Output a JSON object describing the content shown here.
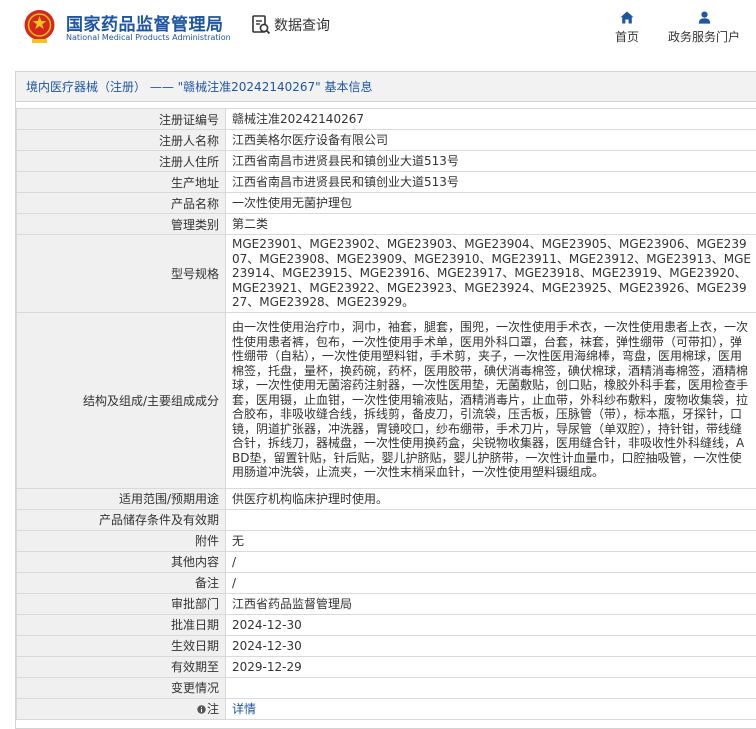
{
  "header": {
    "site_name": "国家药品监督管理局",
    "site_name_en": "National Medical Products Administration",
    "query_label": "数据查询",
    "nav": [
      {
        "label": "首页",
        "icon": "home-icon"
      },
      {
        "label": "政务服务门户",
        "icon": "user-icon"
      }
    ],
    "brand_color": "#1f56a3",
    "emblem_color": "#d7261d"
  },
  "panel": {
    "title": "境内医疗器械（注册） —— \"赣械注准20242140267\" 基本信息"
  },
  "rows": [
    {
      "label": "注册证编号",
      "value": "赣械注准20242140267"
    },
    {
      "label": "注册人名称",
      "value": "江西美格尔医疗设备有限公司"
    },
    {
      "label": "注册人住所",
      "value": "江西省南昌市进贤县民和镇创业大道513号"
    },
    {
      "label": "生产地址",
      "value": "江西省南昌市进贤县民和镇创业大道513号"
    },
    {
      "label": "产品名称",
      "value": "一次性使用无菌护理包"
    },
    {
      "label": "管理类别",
      "value": "第二类"
    },
    {
      "label": "型号规格",
      "value": "MGE23901、MGE23902、MGE23903、MGE23904、MGE23905、MGE23906、MGE23907、MGE23908、MGE23909、MGE23910、MGE23911、MGE23912、MGE23913、MGE23914、MGE23915、MGE23916、MGE23917、MGE23918、MGE23919、MGE23920、MGE23921、MGE23922、MGE23923、MGE23924、MGE23925、MGE23926、MGE23927、MGE23928、MGE23929。"
    },
    {
      "label": "结构及组成/主要组成成分",
      "value": "由一次性使用治疗巾，洞巾，袖套，腿套，围兜，一次性使用手术衣，一次性使用患者上衣，一次性使用患者裤，包布，一次性使用手术单，医用外科口罩，台套，袜套，弹性绷带（可带扣），弹性绷带（自粘），一次性使用塑料钳，手术剪，夹子，一次性医用海绵棒，弯盘，医用棉球，医用棉签，托盘，量杯，换药碗，药杯，医用胶带，碘伏消毒棉签，碘伏棉球，酒精消毒棉签，酒精棉球，一次性使用无菌溶药注射器，一次性医用垫，无菌敷贴，创口贴，橡胶外科手套，医用检查手套，医用镊，止血钳，一次性使用输液贴，酒精消毒片，止血带，外科纱布敷料，废物收集袋，拉合胶布，非吸收缝合线，拆线剪，备皮刀，引流袋，压舌板，压脉管（带），标本瓶，牙探针，口镜，阴道扩张器，冲洗器，胃镜咬口，纱布绷带，手术刀片，导尿管（单双腔），持针钳，带线缝合针，拆线刀，器械盘，一次性使用换药盒，尖锐物收集器，医用缝合针，非吸收性外科缝线，ABD垫，留置针贴，针后贴，婴儿护脐贴，婴儿护脐带，一次性计血量巾，口腔抽吸管，一次性使用肠道冲洗袋，止流夹，一次性末梢采血针，一次性使用塑料镊组成。"
    },
    {
      "label": "适用范围/预期用途",
      "value": "供医疗机构临床护理时使用。"
    },
    {
      "label": "产品储存条件及有效期",
      "value": ""
    },
    {
      "label": "附件",
      "value": "无"
    },
    {
      "label": "其他内容",
      "value": "/"
    },
    {
      "label": "备注",
      "value": "/"
    },
    {
      "label": "审批部门",
      "value": "江西省药品监督管理局"
    },
    {
      "label": "批准日期",
      "value": "2024-12-30"
    },
    {
      "label": "生效日期",
      "value": "2024-12-30"
    },
    {
      "label": "有效期至",
      "value": "2029-12-29"
    },
    {
      "label": "变更情况",
      "value": ""
    },
    {
      "label": "注",
      "value": "详情",
      "icon": "info-icon"
    }
  ]
}
